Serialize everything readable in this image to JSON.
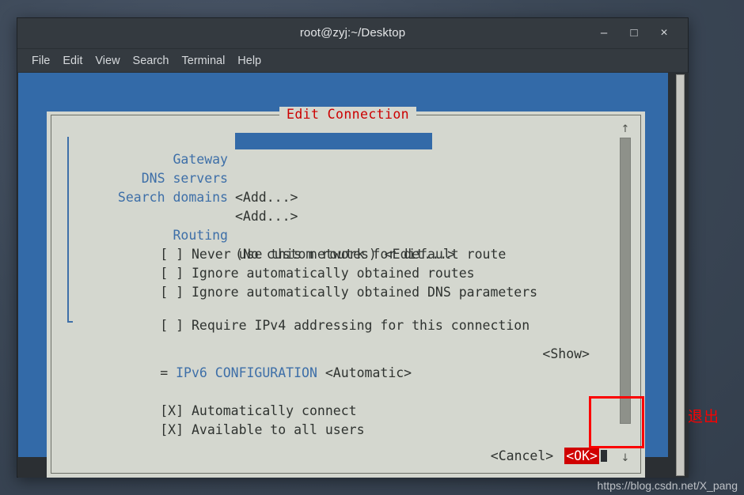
{
  "window": {
    "title": "root@zyj:~/Desktop",
    "controls": {
      "minimize": "–",
      "maximize": "□",
      "close": "×"
    },
    "menu": [
      "File",
      "Edit",
      "View",
      "Search",
      "Terminal",
      "Help"
    ]
  },
  "dialog": {
    "title": "Edit Connection",
    "fields": [
      {
        "label": "Gateway",
        "type": "input",
        "value": ""
      },
      {
        "label": "DNS servers",
        "type": "link",
        "value": "<Add...>"
      },
      {
        "label": "Search domains",
        "type": "link",
        "value": "<Add...>"
      }
    ],
    "routing": {
      "label": "Routing",
      "value": "(No custom routes) <Edit...>"
    },
    "checkboxes": [
      {
        "mark": "[ ]",
        "label": "Never use this network for default route"
      },
      {
        "mark": "[ ]",
        "label": "Ignore automatically obtained routes"
      },
      {
        "mark": "[ ]",
        "label": "Ignore automatically obtained DNS parameters"
      },
      {
        "mark": "[ ]",
        "label": "Require IPv4 addressing for this connection"
      }
    ],
    "ipv6": {
      "bullet": "=",
      "section": "IPv6 CONFIGURATION",
      "value": "<Automatic>",
      "show": "<Show>"
    },
    "options": [
      {
        "mark": "[X]",
        "label": "Automatically connect"
      },
      {
        "mark": "[X]",
        "label": "Available to all users"
      }
    ],
    "buttons": {
      "cancel": "<Cancel>",
      "ok": "<OK>"
    },
    "scrollbar": {
      "up": "↑",
      "down": "↓"
    }
  },
  "annotations": {
    "exit_label": "退出",
    "highlight_color": "#fb0000"
  },
  "watermark": "https://blog.csdn.net/X_pang"
}
